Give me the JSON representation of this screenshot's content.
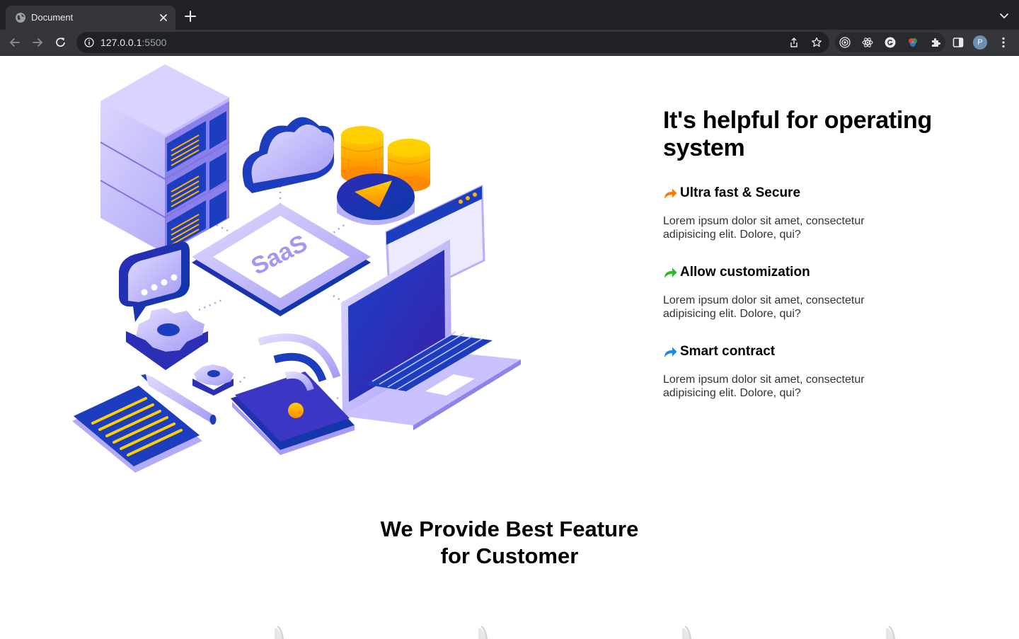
{
  "browser": {
    "tab_title": "Document",
    "url_host": "127.0.0.1",
    "url_port": ":5500",
    "profile_initial": "P",
    "icons": {
      "favicon": "globe-icon",
      "close": "close-icon",
      "new_tab": "plus-icon",
      "back": "back-arrow-icon",
      "forward": "forward-arrow-icon",
      "reload": "reload-icon",
      "site_info": "info-icon",
      "share": "share-icon",
      "bookmark": "star-icon",
      "extensions": "puzzle-icon",
      "side_panel": "side-panel-icon",
      "menu": "kebab-menu-icon"
    }
  },
  "hero": {
    "illustration": "saas-isometric-illustration",
    "title": "It's helpful for operating system",
    "features": [
      {
        "title": "Ultra fast & Secure",
        "text": "Lorem ipsum dolor sit amet, consectetur adipisicing elit. Dolore, qui?",
        "arrow_color": "#f57c00"
      },
      {
        "title": "Allow customization",
        "text": "Lorem ipsum dolor sit amet, consectetur adipisicing elit. Dolore, qui?",
        "arrow_color": "#2eb82e"
      },
      {
        "title": "Smart contract",
        "text": "Lorem ipsum dolor sit amet, consectetur adipisicing elit. Dolore, qui?",
        "arrow_color": "#1e88e5"
      }
    ]
  },
  "features_section": {
    "title_line1": "We Provide Best Feature",
    "title_line2": "for Customer"
  }
}
